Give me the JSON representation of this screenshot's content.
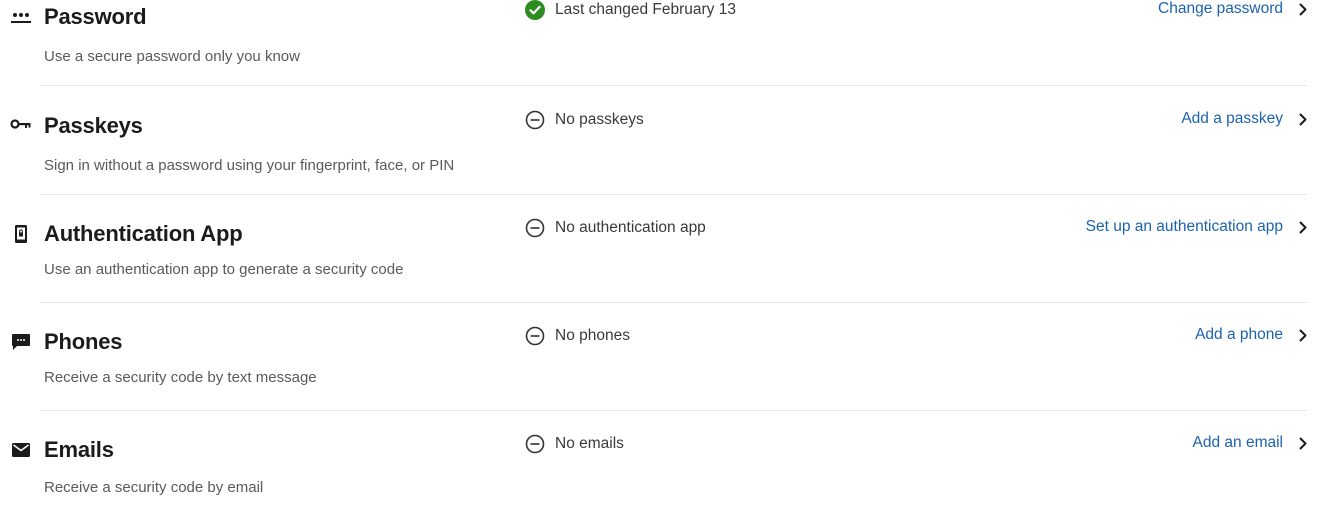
{
  "methods": [
    {
      "key": "password",
      "icon": "password-dots-icon",
      "title": "Password",
      "description": "Use a secure password only you know",
      "status_icon": "check-circle-icon",
      "status": "Last changed February 13",
      "action": "Change password"
    },
    {
      "key": "passkeys",
      "icon": "key-icon",
      "title": "Passkeys",
      "description": "Sign in without a password using your fingerprint, face, or PIN",
      "status_icon": "minus-circle-icon",
      "status": "No passkeys",
      "action": "Add a passkey"
    },
    {
      "key": "authentication-app",
      "icon": "phone-lock-icon",
      "title": "Authentication App",
      "description": "Use an authentication app to generate a security code",
      "status_icon": "minus-circle-icon",
      "status": "No authentication app",
      "action": "Set up an authentication app"
    },
    {
      "key": "phones",
      "icon": "message-icon",
      "title": "Phones",
      "description": "Receive a security code by text message",
      "status_icon": "minus-circle-icon",
      "status": "No phones",
      "action": "Add a phone"
    },
    {
      "key": "emails",
      "icon": "envelope-icon",
      "title": "Emails",
      "description": "Receive a security code by email",
      "status_icon": "minus-circle-icon",
      "status": "No emails",
      "action": "Add an email"
    }
  ],
  "colors": {
    "link": "#1c63ad",
    "success": "#2e8b22",
    "divider": "#e5e5e5"
  }
}
